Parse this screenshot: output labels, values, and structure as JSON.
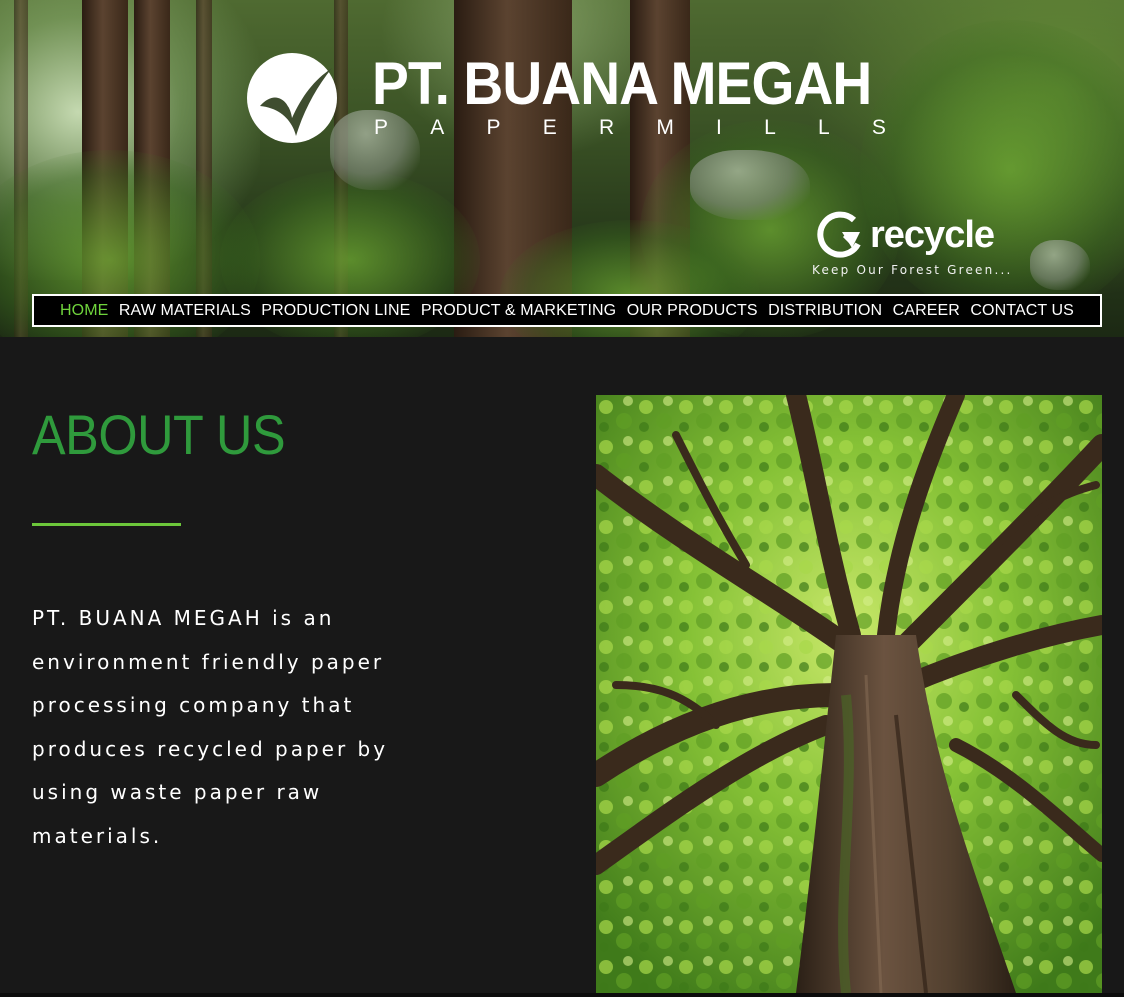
{
  "header": {
    "brand_title": "PT. BUANA MEGAH",
    "brand_subtitle_letters": [
      "P",
      "A",
      "P",
      "E",
      "R",
      "M",
      "I",
      "L",
      "L",
      "S"
    ],
    "logo_icon": "checkmark-circle-logo",
    "recycle_word": "recycle",
    "recycle_tagline": "Keep Our Forest Green...",
    "recycle_icon": "recycle-arrow-icon"
  },
  "nav": {
    "items": [
      {
        "label": "HOME",
        "active": true
      },
      {
        "label": "RAW MATERIALS"
      },
      {
        "label": "PRODUCTION LINE"
      },
      {
        "label": "PRODUCT & MARKETING"
      },
      {
        "label": "OUR PRODUCTS"
      },
      {
        "label": "DISTRIBUTION"
      },
      {
        "label": "CAREER"
      },
      {
        "label": "CONTACT US"
      }
    ],
    "active_color": "#6fd43c"
  },
  "about": {
    "title": "ABOUT US",
    "title_color": "#2f9a3c",
    "rule_color": "#6cc73a",
    "body": "PT. BUANA MEGAH is an environment friendly paper processing company that produces recycled paper by using waste paper raw materials."
  },
  "colors": {
    "background": "#181818",
    "nav_background": "#000000"
  }
}
